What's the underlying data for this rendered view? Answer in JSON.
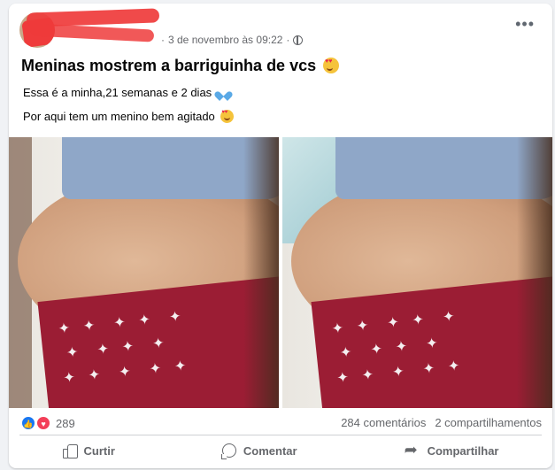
{
  "post": {
    "date": "3 de novembro às 09:22",
    "separator": "·",
    "more_label": "•••",
    "title": "Meninas mostrem a barriguinha de vcs",
    "line1": "Essa é a minha,21 semanas e 2 dias",
    "line2": "Por aqui tem um menino bem agitado"
  },
  "stats": {
    "reactions_count": "289",
    "comments": "284 comentários",
    "shares": "2 compartilhamentos"
  },
  "actions": {
    "like_label": "Curtir",
    "comment_label": "Comentar",
    "share_label": "Compartilhar"
  },
  "icons": {
    "privacy": "globe-icon",
    "like": "thumbs-up-icon",
    "comment": "comment-bubble-icon",
    "share": "share-arrow-icon",
    "reaction_like": "like-reaction-icon",
    "reaction_love": "love-reaction-icon"
  },
  "colors": {
    "accent": "#1877f2",
    "love": "#f33e58",
    "muted_text": "#65676b"
  }
}
